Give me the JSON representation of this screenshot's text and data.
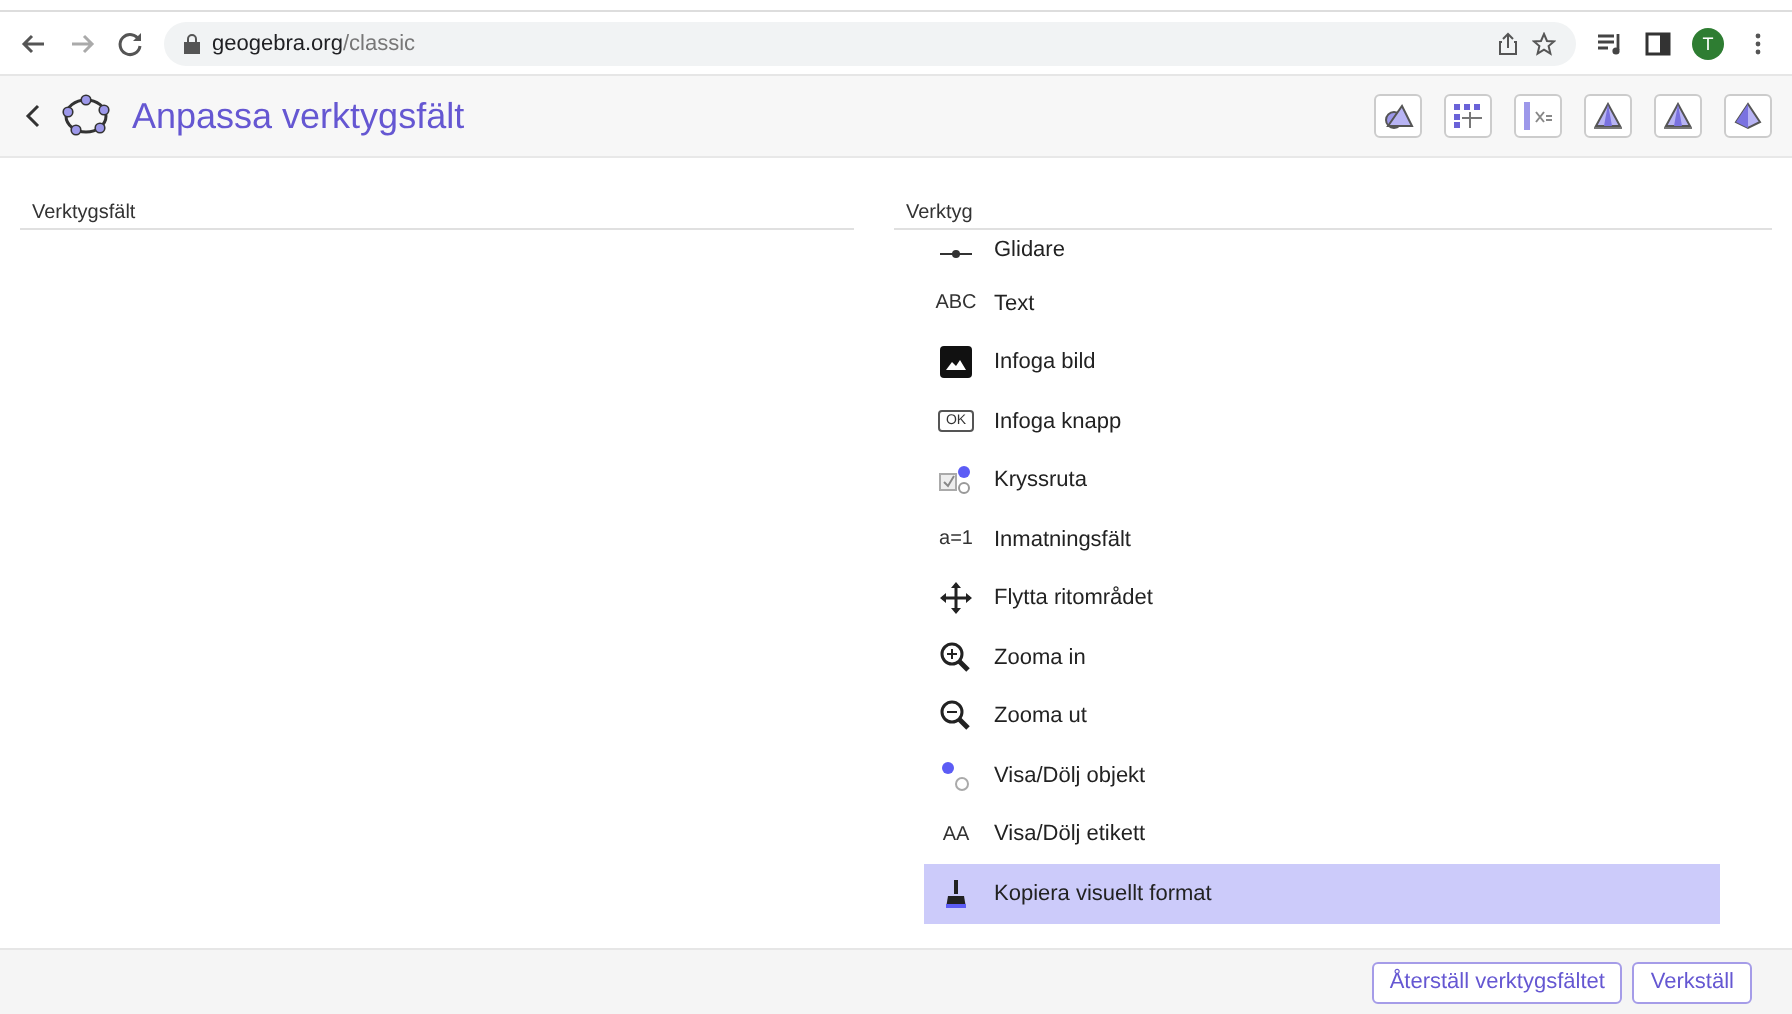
{
  "browser": {
    "url_host": "geogebra.org",
    "url_path": "/classic",
    "profile_initial": "T"
  },
  "header": {
    "title": "Anpassa verktygsfält",
    "toolbar_buttons": [
      {
        "kind": "geometry"
      },
      {
        "kind": "grid"
      },
      {
        "kind": "algebra"
      },
      {
        "kind": "graph3d"
      },
      {
        "kind": "graph3d"
      },
      {
        "kind": "pyramid"
      }
    ]
  },
  "left_panel": {
    "label": "Verktygsfält"
  },
  "right_panel": {
    "label": "Verktyg",
    "tools": [
      {
        "kind": "slider",
        "label": "Glidare",
        "selected": false
      },
      {
        "kind": "text",
        "label": "Text",
        "icon_text": "ABC",
        "selected": false
      },
      {
        "kind": "image",
        "label": "Infoga bild",
        "selected": false
      },
      {
        "kind": "button",
        "label": "Infoga knapp",
        "icon_text": "OK",
        "selected": false
      },
      {
        "kind": "checkbox",
        "label": "Kryssruta",
        "selected": false
      },
      {
        "kind": "input",
        "label": "Inmatningsfält",
        "icon_text": "a=1",
        "selected": false
      },
      {
        "kind": "move",
        "label": "Flytta ritområdet",
        "selected": false
      },
      {
        "kind": "zoomin",
        "label": "Zooma in",
        "selected": false
      },
      {
        "kind": "zoomout",
        "label": "Zooma ut",
        "selected": false
      },
      {
        "kind": "showhide",
        "label": "Visa/Dölj objekt",
        "selected": false
      },
      {
        "kind": "labels",
        "label": "Visa/Dölj etikett",
        "icon_text": "AA",
        "selected": false
      },
      {
        "kind": "brush",
        "label": "Kopiera visuellt format",
        "selected": true
      }
    ]
  },
  "footer": {
    "buttons": [
      "Återställ verktygsfältet",
      "Verkställ"
    ]
  }
}
